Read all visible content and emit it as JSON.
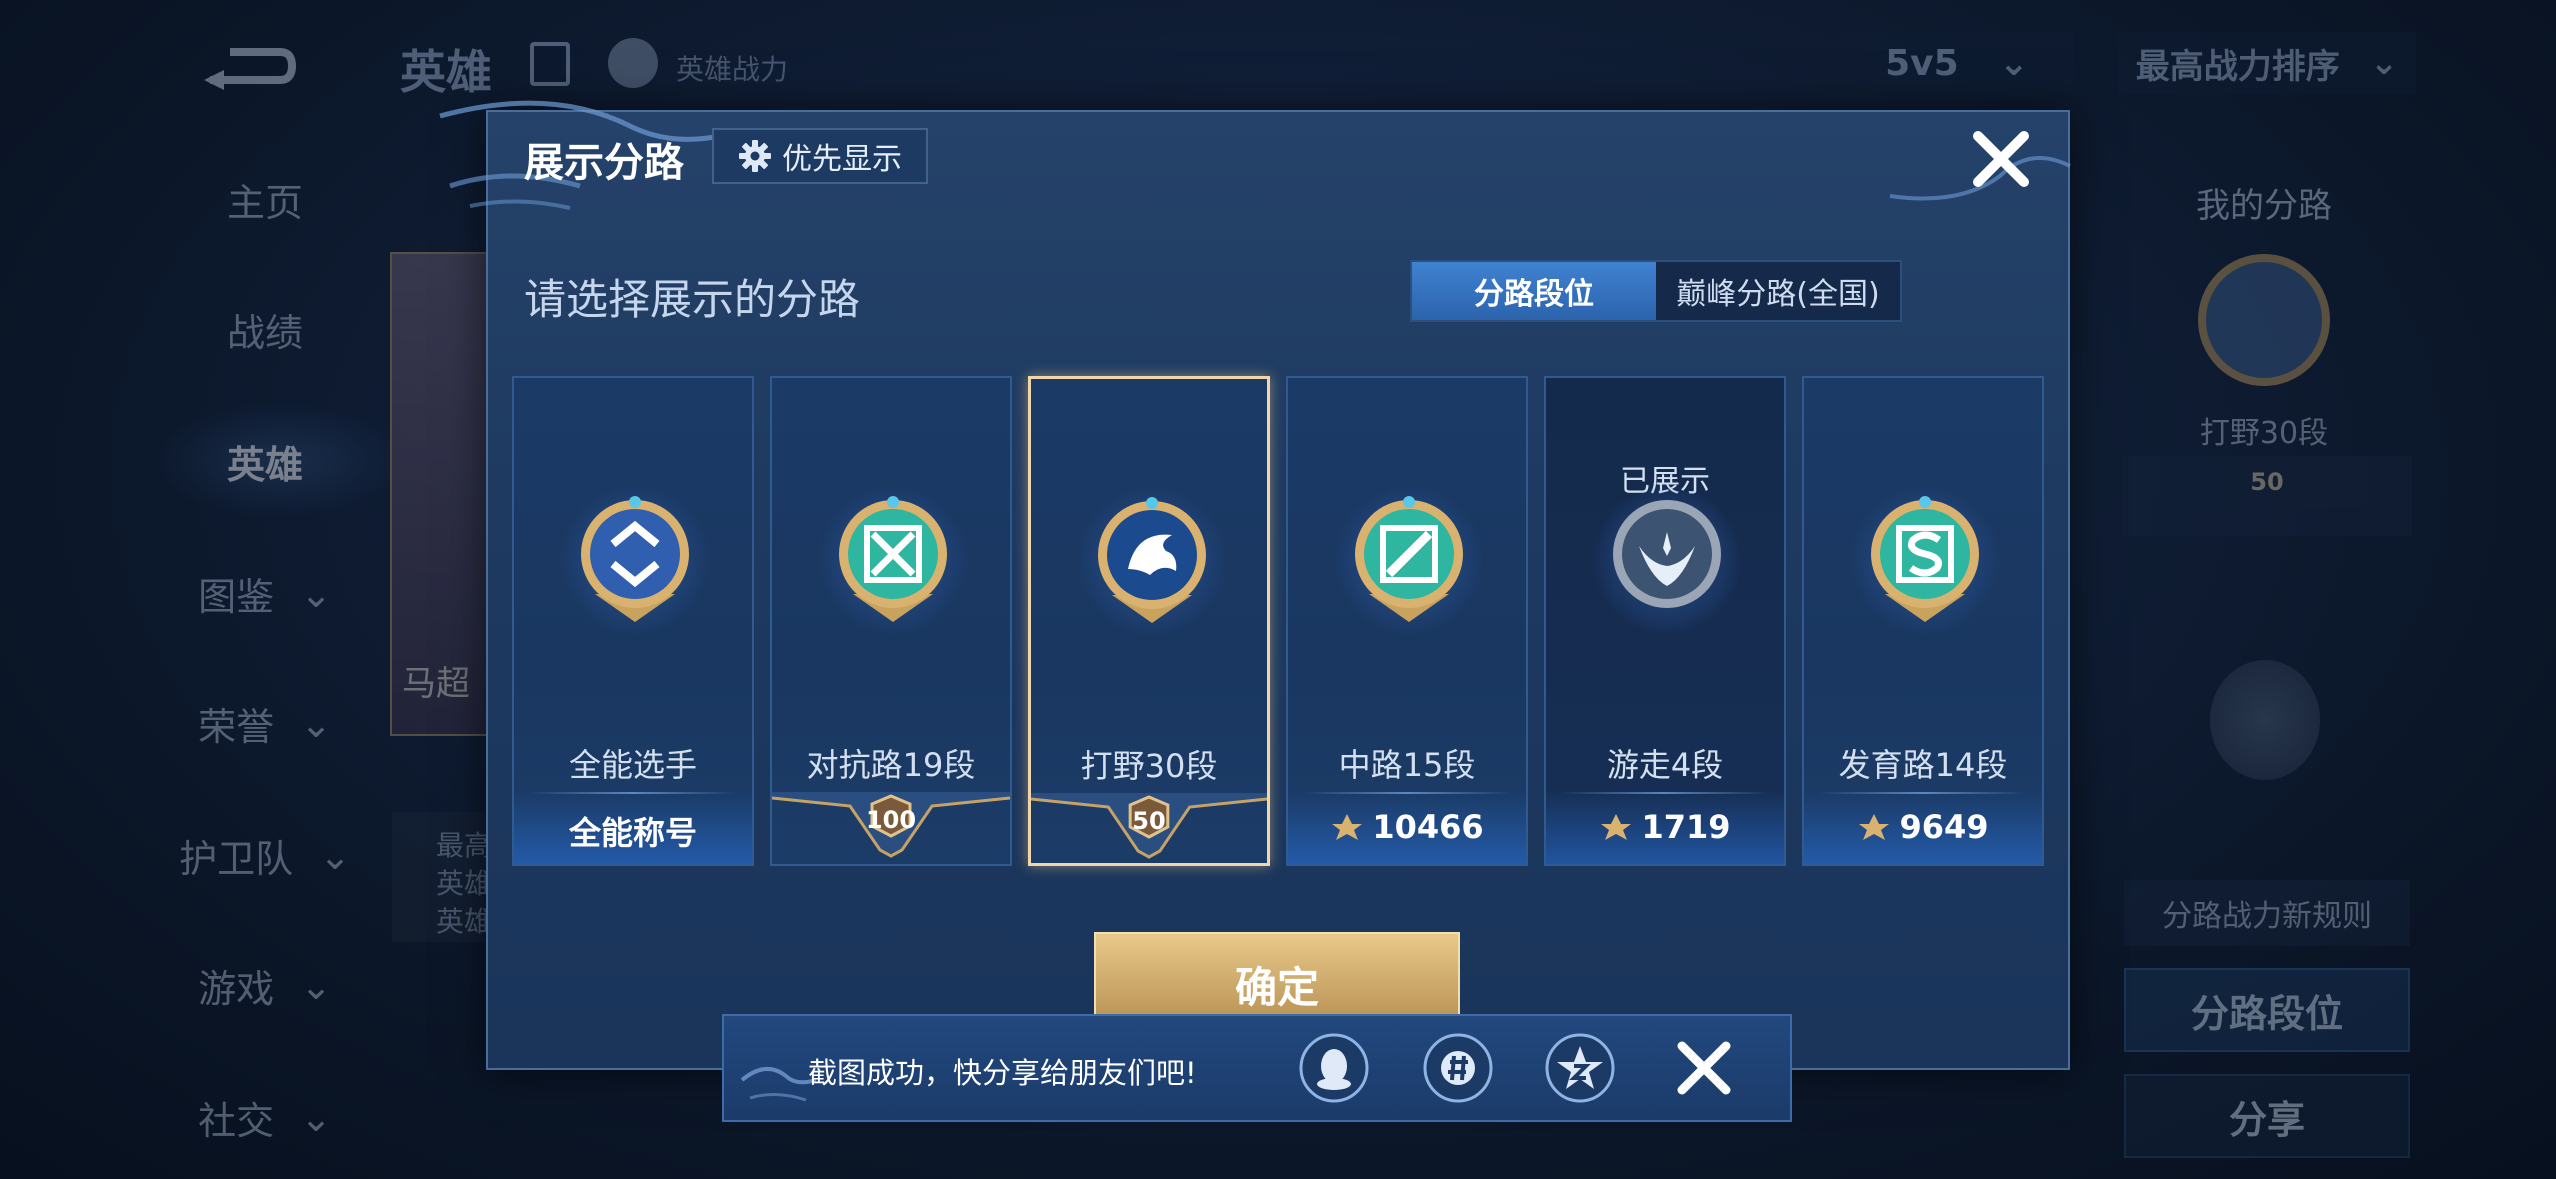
{
  "background": {
    "header": {
      "title": "英雄",
      "power_label": "英雄战力",
      "mode_select": "5v5",
      "sort_select": "最高战力排序"
    },
    "nav": [
      {
        "label": "主页",
        "has_chevron": false
      },
      {
        "label": "战绩",
        "has_chevron": false
      },
      {
        "label": "英雄",
        "has_chevron": false,
        "active": true
      },
      {
        "label": "图鉴",
        "has_chevron": true
      },
      {
        "label": "荣誉",
        "has_chevron": true
      },
      {
        "label": "护卫队",
        "has_chevron": true
      },
      {
        "label": "游戏",
        "has_chevron": true
      },
      {
        "label": "社交",
        "has_chevron": true
      }
    ],
    "hero_card": {
      "name": "马超",
      "info_lines": [
        "最高",
        "英雄",
        "英雄"
      ]
    },
    "right_panel": {
      "title": "我的分路",
      "rank": "打野30段",
      "rank_number": "50",
      "rule_link": "分路战力新规则",
      "button_lane_rank": "分路段位",
      "button_share": "分享"
    }
  },
  "modal": {
    "title": "展示分路",
    "priority_button": "优先显示",
    "prompt": "请选择展示的分路",
    "tabs": [
      {
        "label": "分路段位",
        "active": true
      },
      {
        "label": "巅峰分路(全国)",
        "active": false
      }
    ],
    "cards": [
      {
        "name": "全能选手",
        "value": "全能称号",
        "type": "title",
        "badge": "all-round-badge-icon"
      },
      {
        "name": "对抗路19段",
        "value": "100",
        "type": "rank",
        "badge": "clash-lane-badge-icon"
      },
      {
        "name": "打野30段",
        "value": "50",
        "type": "rank",
        "badge": "jungle-badge-icon",
        "selected": true
      },
      {
        "name": "中路15段",
        "value": "10466",
        "type": "score",
        "badge": "mid-lane-badge-icon"
      },
      {
        "name": "游走4段",
        "value": "1719",
        "type": "score",
        "badge": "roam-badge-icon",
        "status": "已展示"
      },
      {
        "name": "发育路14段",
        "value": "9649",
        "type": "score",
        "badge": "farm-lane-badge-icon"
      }
    ],
    "confirm_button": "确定"
  },
  "toast": {
    "message": "截图成功，快分享给朋友们吧!",
    "icons": [
      "qq-icon",
      "moments-icon",
      "qzone-icon"
    ]
  },
  "colors": {
    "modal_bg": "#1e3a60",
    "accent_blue": "#3f82d0",
    "gold": "#d8b26e",
    "selected_border": "#f0d6a8"
  }
}
